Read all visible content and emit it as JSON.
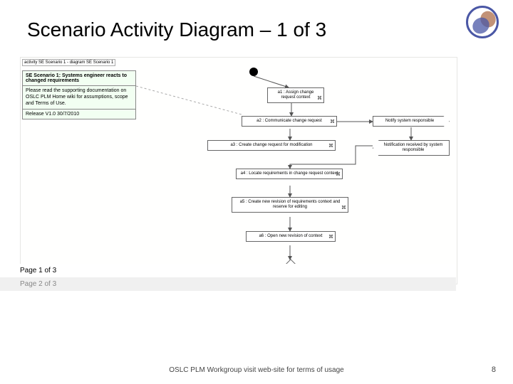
{
  "header": {
    "title": "Scenario Activity Diagram – 1 of 3"
  },
  "frame_label": "activity  SE Scenario 1 - diagram SE Scenario 1",
  "note": {
    "title": "SE Scenario 1: Systems engineer reacts to changed requirements",
    "body": "Please read the supporting documentation on OSLC PLM Home wiki for assumptions, scope and Terms of Use.",
    "release": "Release V1.0 30/7/2010"
  },
  "activities": {
    "a1": "a1 : Assign change request context",
    "a2": "a2 : Communicate change request",
    "a3": "a3 : Create change request for modification",
    "a4": "a4 : Locate requirements in change request context",
    "a5": "a5 : Create new revision of requirements context and reserve for editing",
    "a6": "a6 : Open new revision of context"
  },
  "signals": {
    "notify": "Notify system responsible",
    "received": "Notification received by system responsible"
  },
  "pages": {
    "p1": "Page 1 of 3",
    "p2": "Page 2 of 3"
  },
  "footer": {
    "text": "OSLC PLM Workgroup visit web-site for terms of usage",
    "page": "8"
  }
}
